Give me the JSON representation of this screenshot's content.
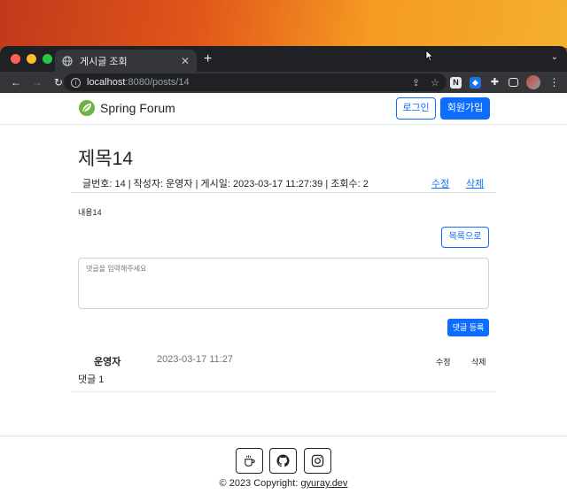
{
  "browser": {
    "tab_title": "게시글 조회",
    "new_tab": "+",
    "url_host": "localhost",
    "url_rest": ":8080/posts/14"
  },
  "site": {
    "brand": "Spring Forum",
    "login": "로그인",
    "signup": "회원가입"
  },
  "post": {
    "title": "제목14",
    "meta": "글번호: 14 | 작성자: 운영자 | 게시일: 2023-03-17 11:27:39 | 조회수: 2",
    "edit": "수정",
    "delete": "삭제",
    "content": "내용14",
    "list_button": "목록으로"
  },
  "comment_form": {
    "placeholder": "댓글을 입력해주세요",
    "submit": "댓글 등록"
  },
  "comments": [
    {
      "author": "운영자",
      "date": "2023-03-17 11:27",
      "edit": "수정",
      "delete": "삭제",
      "body": "댓글 1"
    }
  ],
  "footer": {
    "copyright_prefix": "© 2023 Copyright: ",
    "copyright_link": "gyuray.dev"
  },
  "colors": {
    "primary": "#0d6efd",
    "brand_green": "#6db33f"
  }
}
